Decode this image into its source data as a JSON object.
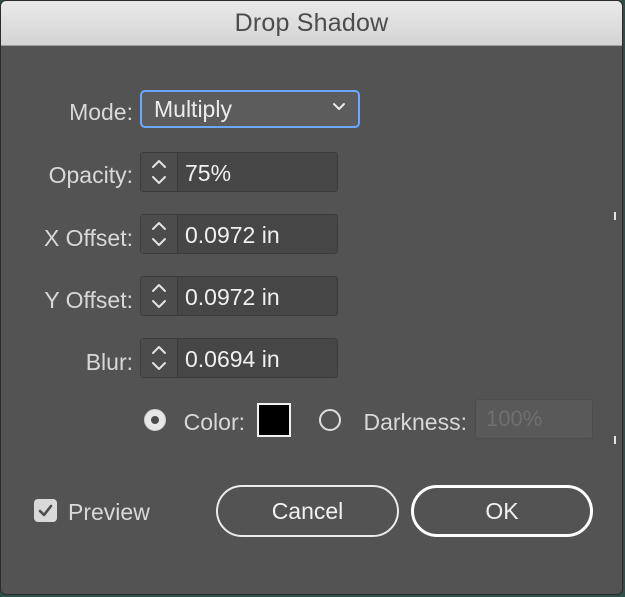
{
  "window": {
    "title": "Drop Shadow"
  },
  "form": {
    "mode": {
      "label": "Mode:",
      "value": "Multiply"
    },
    "opacity": {
      "label": "Opacity:",
      "value": "75%"
    },
    "x_offset": {
      "label": "X Offset:",
      "value": "0.0972 in"
    },
    "y_offset": {
      "label": "Y Offset:",
      "value": "0.0972 in"
    },
    "blur": {
      "label": "Blur:",
      "value": "0.0694 in"
    },
    "color_option": {
      "label": "Color:",
      "selected": true,
      "swatch_color": "#000000"
    },
    "darkness_option": {
      "label": "Darkness:",
      "selected": false,
      "value": "100%"
    }
  },
  "footer": {
    "preview_label": "Preview",
    "preview_checked": true,
    "cancel_label": "Cancel",
    "ok_label": "OK"
  },
  "icons": {
    "select_arrow": "chevron-down-icon",
    "stepper": "stepper-icon",
    "checkbox": "checkmark-icon"
  },
  "colors": {
    "dialog_bg": "#535353",
    "focus_ring": "#6aa7ff",
    "text": "#d8d8d8"
  }
}
